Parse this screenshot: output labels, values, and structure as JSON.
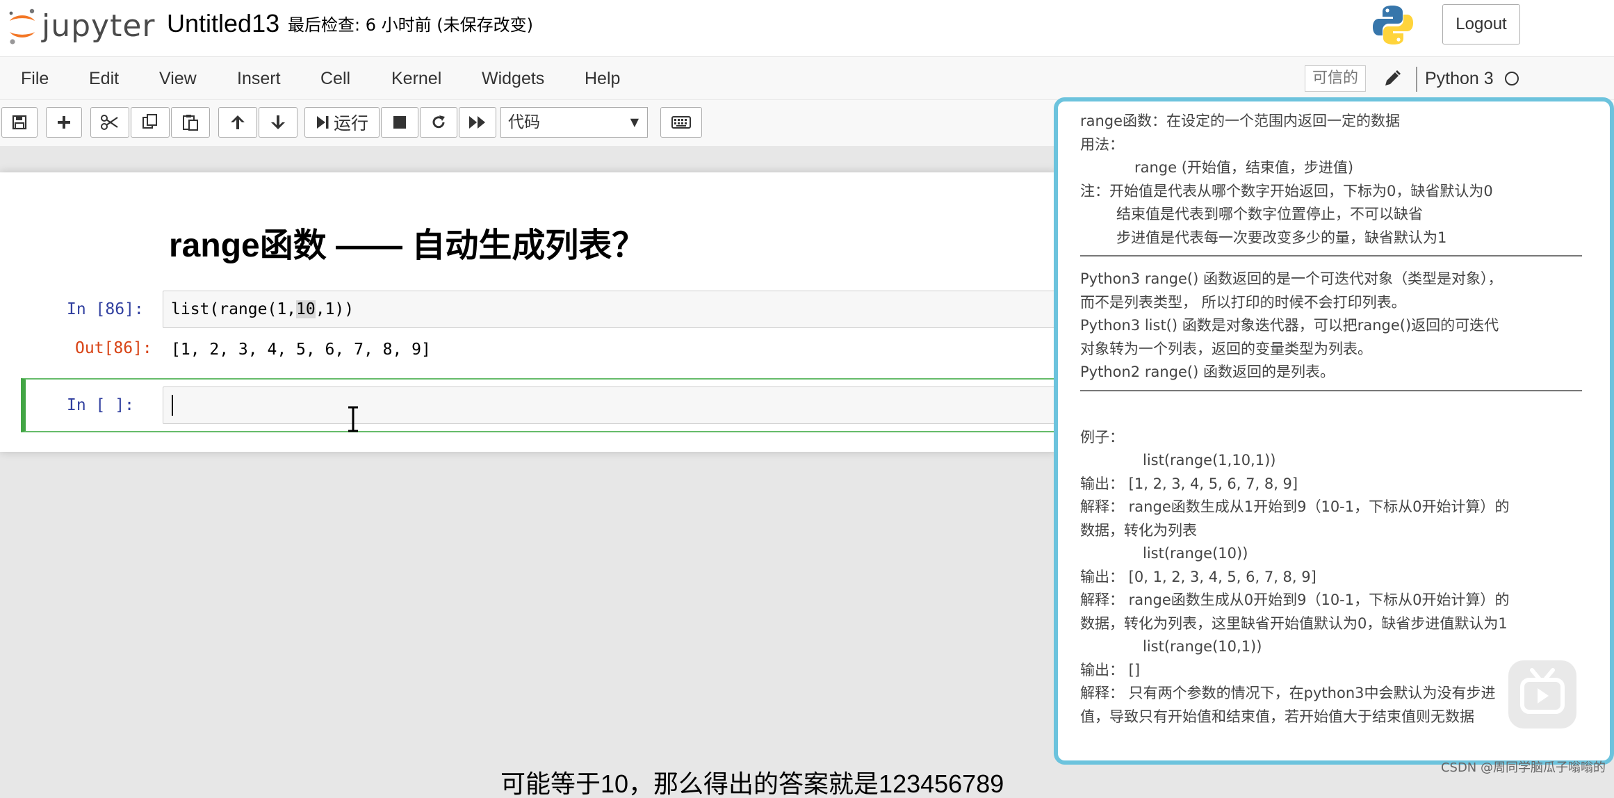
{
  "header": {
    "logo_text": "jupyter",
    "notebook_title": "Untitled13",
    "checkpoint_text": "最后检查: 6 小时前  (未保存改变)",
    "logout_label": "Logout"
  },
  "menubar": {
    "items": [
      "File",
      "Edit",
      "View",
      "Insert",
      "Cell",
      "Kernel",
      "Widgets",
      "Help"
    ],
    "trusted_label": "可信的",
    "kernel_name": "Python 3"
  },
  "toolbar": {
    "run_label": "运行",
    "cell_type_selected": "代码"
  },
  "notebook": {
    "heading": "range函数 —— 自动生成列表？",
    "cells": [
      {
        "in_prompt": "In  [86]:",
        "code_before": "list(range(1,",
        "code_highlight": "10",
        "code_after": ",1))",
        "out_prompt": "Out[86]:",
        "output": "[1, 2, 3, 4, 5, 6, 7, 8, 9]"
      },
      {
        "in_prompt": "In  [ ]:",
        "code": ""
      }
    ]
  },
  "panel": {
    "lines": [
      "range函数：在设定的一个范围内返回一定的数据",
      "用法：",
      "range (开始值，结束值，步进值)",
      "注：开始值是代表从哪个数字开始返回，下标为0，缺省默认为0",
      "结束值是代表到哪个数字位置停止，不可以缺省",
      "步进值是代表每一次要改变多少的量，缺省默认为1",
      "Python3 range() 函数返回的是一个可迭代对象（类型是对象），",
      "而不是列表类型， 所以打印的时候不会打印列表。",
      "Python3 list() 函数是对象迭代器，可以把range()返回的可迭代",
      "对象转为一个列表，返回的变量类型为列表。",
      "Python2 range() 函数返回的是列表。",
      "例子：",
      "list(range(1,10,1))",
      "输出： [1, 2, 3, 4, 5, 6, 7, 8, 9]",
      "解释： range函数生成从1开始到9（10-1，下标从0开始计算）的",
      "数据，转化为列表",
      "list(range(10))",
      "输出： [0, 1, 2, 3, 4, 5, 6, 7, 8, 9]",
      "解释： range函数生成从0开始到9（10-1，下标从0开始计算）的",
      "数据，转化为列表，这里缺省开始值默认为0，缺省步进值默认为1",
      "list(range(10,1))",
      "输出： []",
      "解释： 只有两个参数的情况下，在python3中会默认为没有步进",
      "值，导致只有开始值和结束值，若开始值大于结束值则无数据"
    ]
  },
  "overlay": {
    "subtitle": "可能等于10，那么得出的答案就是123456789",
    "watermark": "CSDN @周同学脑瓜子嗡嗡的"
  }
}
